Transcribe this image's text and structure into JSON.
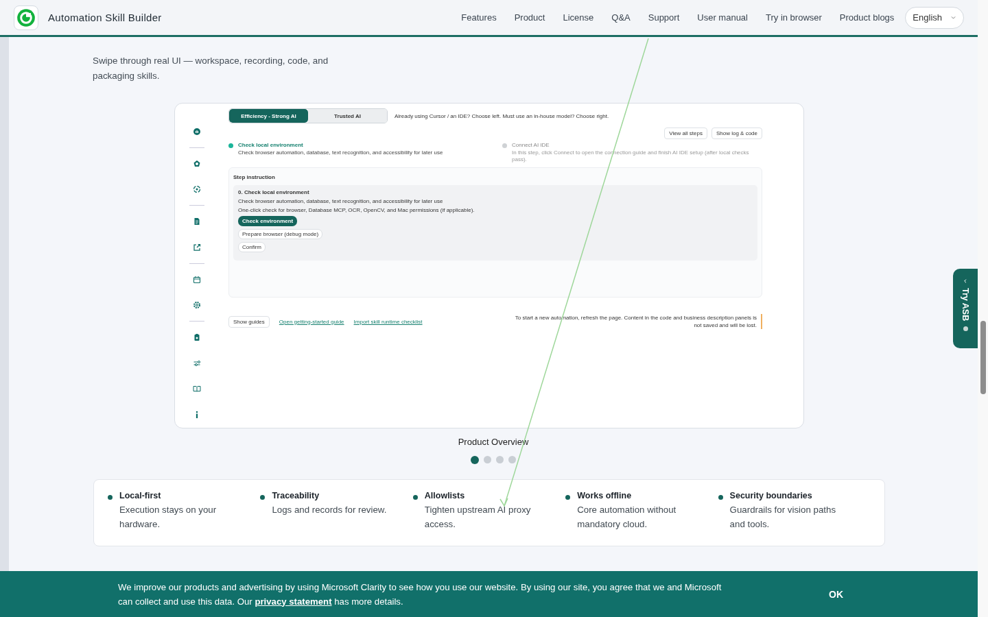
{
  "header": {
    "brand": "Automation Skill Builder",
    "nav": [
      "Features",
      "Product",
      "License",
      "Q&A",
      "Support",
      "User manual",
      "Try in browser",
      "Product blogs"
    ],
    "language": "English"
  },
  "section": {
    "subtitle": "Swipe through real UI — workspace, recording, code, and packaging skills."
  },
  "screenshot": {
    "mode_tabs": [
      {
        "label": "Efficiency - Strong AI",
        "selected": true
      },
      {
        "label": "Trusted AI",
        "selected": false
      }
    ],
    "mode_hint": "Already using Cursor / an IDE? Choose left. Must use an in-house model? Choose right.",
    "action_buttons": [
      "View all steps",
      "Show log & code"
    ],
    "steps": [
      {
        "title": "Check local environment",
        "description": "Check browser automation, database, text recognition, and accessibility for later use",
        "active": true
      },
      {
        "title": "Connect AI IDE",
        "description": "In this step, click Connect to open the connection guide and finish AI IDE setup (after local checks pass).",
        "active": false
      }
    ],
    "instruction": {
      "heading": "Step instruction",
      "step_title": "0. Check local environment",
      "lines": [
        "Check browser automation, database, text recognition, and accessibility for later use",
        "One-click check for browser, Database MCP, OCR, OpenCV, and Mac permissions (if applicable)."
      ],
      "primary_button": "Check environment",
      "buttons": [
        "Prepare browser (debug mode)",
        "Confirm"
      ]
    },
    "show_guides": "Show guides",
    "links": [
      "Open getting-started guide",
      "Import skill runtime checklist"
    ],
    "notice": "To start a new automation, refresh the page. Content in the code and business description panels is not saved and will be lost."
  },
  "carousel": {
    "caption": "Product Overview",
    "dots": [
      {
        "selected": true
      },
      {
        "selected": false
      },
      {
        "selected": false
      },
      {
        "selected": false
      }
    ]
  },
  "features": [
    {
      "title": "Local-first",
      "text": "Execution stays on your hardware."
    },
    {
      "title": "Traceability",
      "text": "Logs and records for review."
    },
    {
      "title": "Allowlists",
      "text": "Tighten upstream AI proxy access."
    },
    {
      "title": "Works offline",
      "text": "Core automation without mandatory cloud."
    },
    {
      "title": "Security boundaries",
      "text": "Guardrails for vision paths and tools."
    }
  ],
  "side_tab": {
    "label": "Try ASB"
  },
  "cookie_banner": {
    "text_before": "We improve our products and advertising by using Microsoft Clarity to see how you use our website. By using our site, you agree that we and Microsoft can collect and use this data. Our",
    "link": "privacy statement",
    "text_after": "has more details.",
    "button": "OK"
  }
}
